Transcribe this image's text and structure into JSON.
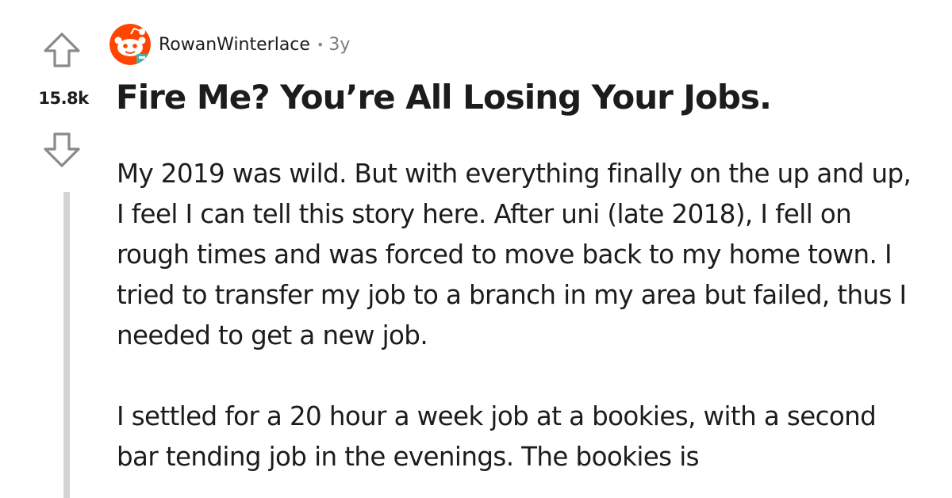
{
  "post": {
    "author": "RowanWinterlace",
    "separator": "•",
    "age": "3y",
    "score": "15.8k",
    "title": "Fire Me? You’re All Losing Your Jobs.",
    "paragraphs": [
      "My 2019 was wild. But with everything finally on the up and up, I feel I can tell this story here. After uni (late 2018), I fell on rough times and was forced to move back to my home town. I tried to transfer my job to a branch in my area but failed, thus I needed to get a new job.",
      "I settled for a 20 hour a week job at a bookies, with a second bar tending job in the evenings. The bookies is"
    ]
  },
  "icons": {
    "upvote": "upvote-arrow-icon",
    "downvote": "downvote-arrow-icon",
    "avatar": "reddit-snoo-avatar-icon"
  },
  "colors": {
    "text": "#1c1c1c",
    "meta": "#7c7c7c",
    "arrow": "#878a8c",
    "thread_line": "#d4d4d4",
    "avatar_orange": "#ff4500"
  }
}
